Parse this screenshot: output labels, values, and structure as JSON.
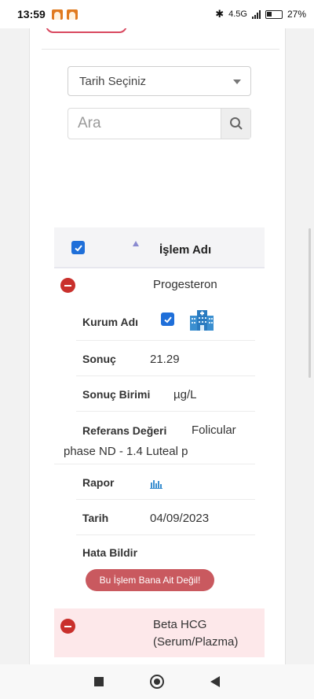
{
  "status_bar": {
    "time": "13:59",
    "network": "4.5G",
    "battery": "27%"
  },
  "filters": {
    "date_select": "Tarih Seçiniz",
    "search_placeholder": "Ara"
  },
  "table": {
    "header": {
      "title": "İşlem Adı"
    },
    "rows": [
      {
        "name": "Progesteron",
        "details": {
          "kurum_label": "Kurum Adı",
          "sonuc_label": "Sonuç",
          "sonuc_value": "21.29",
          "birim_label": "Sonuç Birimi",
          "birim_value": "µg/L",
          "referans_label": "Referans Değeri",
          "referans_value_line1": "Folicular",
          "referans_value_line2": "phase ND - 1.4 Luteal p",
          "rapor_label": "Rapor",
          "tarih_label": "Tarih",
          "tarih_value": "04/09/2023",
          "hata_label": "Hata Bildir",
          "hata_button": "Bu İşlem Bana Ait Değil!"
        }
      },
      {
        "name_line1": "Beta HCG",
        "name_line2": "(Serum/Plazma)"
      }
    ]
  },
  "colors": {
    "accent_blue": "#1f6fd9",
    "danger_red": "#c9302c",
    "error_button": "#c9595f",
    "pink_row": "#fde8ea"
  }
}
